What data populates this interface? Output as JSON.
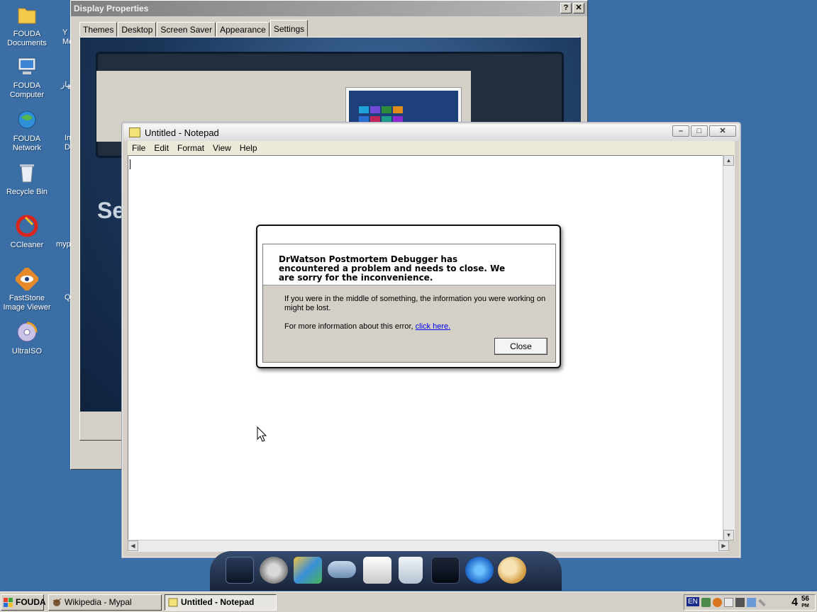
{
  "desktop": {
    "icons": [
      {
        "label": "FOUDA\nDocuments"
      },
      {
        "label": "FOUDA\nComputer"
      },
      {
        "label": "FOUDA\nNetwork"
      },
      {
        "label": "Recycle Bin"
      },
      {
        "label": "CCleaner"
      },
      {
        "label": "FastStone\nImage Viewer"
      },
      {
        "label": "UltraISO"
      }
    ],
    "partial_labels": [
      "Y\nMe",
      "جهاز",
      "In\nDe",
      "myp",
      "Q"
    ]
  },
  "display_properties": {
    "title": "Display Properties",
    "help_glyph": "?",
    "close_glyph": "✕",
    "tabs": [
      "Themes",
      "Desktop",
      "Screen Saver",
      "Appearance",
      "Settings"
    ],
    "active_tab": "Settings",
    "preview_text": "Se"
  },
  "notepad": {
    "title": "Untitled - Notepad",
    "menu": [
      "File",
      "Edit",
      "Format",
      "View",
      "Help"
    ],
    "controls": {
      "minimize": "–",
      "maximize": "□",
      "close": "✕"
    },
    "content": ""
  },
  "error_dialog": {
    "heading": "DrWatson Postmortem Debugger has encountered a problem and needs to close.  We are sorry for the inconvenience.",
    "body_line1": "If you were in the middle of something, the information you were working on might be lost.",
    "body_line2_prefix": "For more information about this error, ",
    "body_link": "click here.",
    "close_button": "Close"
  },
  "taskbar": {
    "start_label": "FOUDA",
    "tasks": [
      {
        "label": "Wikipedia - Mypal",
        "active": false
      },
      {
        "label": "Untitled - Notepad",
        "active": true
      }
    ],
    "tray": {
      "language": "EN",
      "clock_hour": "4",
      "clock_minute": "56",
      "clock_ampm": "PM"
    }
  },
  "colors": {
    "desktop_bg": "#3a6ea5",
    "dialog_gray": "#d4d0c8",
    "link": "#0000ee"
  }
}
